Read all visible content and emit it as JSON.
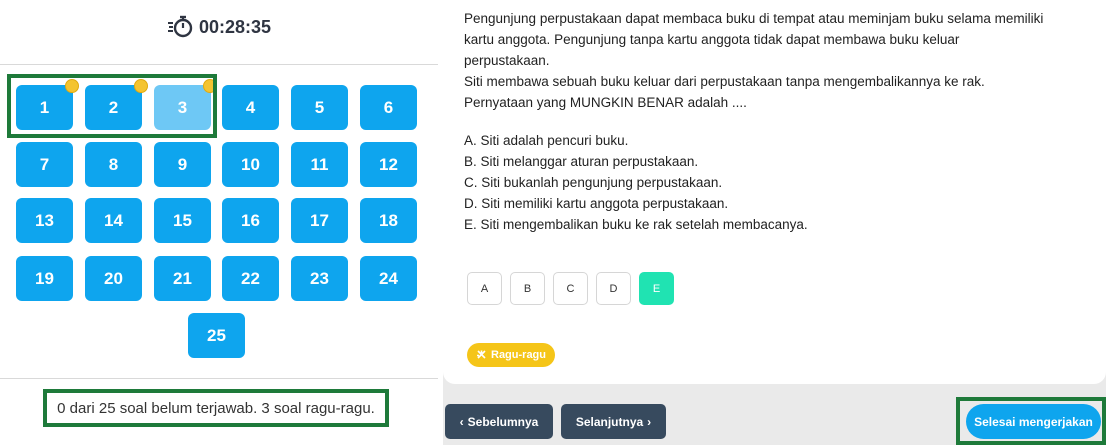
{
  "timer": {
    "icon": "stopwatch-icon",
    "text": "00:28:35"
  },
  "questions": [
    {
      "n": "1",
      "flag": true,
      "current": false
    },
    {
      "n": "2",
      "flag": true,
      "current": false
    },
    {
      "n": "3",
      "flag": true,
      "current": true
    },
    {
      "n": "4"
    },
    {
      "n": "5"
    },
    {
      "n": "6"
    },
    {
      "n": "7"
    },
    {
      "n": "8"
    },
    {
      "n": "9"
    },
    {
      "n": "10"
    },
    {
      "n": "11"
    },
    {
      "n": "12"
    },
    {
      "n": "13"
    },
    {
      "n": "14"
    },
    {
      "n": "15"
    },
    {
      "n": "16"
    },
    {
      "n": "17"
    },
    {
      "n": "18"
    },
    {
      "n": "19"
    },
    {
      "n": "20"
    },
    {
      "n": "21"
    },
    {
      "n": "22"
    },
    {
      "n": "23"
    },
    {
      "n": "24"
    },
    {
      "n": "25"
    }
  ],
  "status_text": "0 dari 25 soal belum terjawab. 3 soal ragu-ragu.",
  "question": {
    "lines": [
      "Pengunjung perpustakaan dapat membaca buku di tempat atau meminjam buku selama memiliki",
      "kartu anggota. Pengunjung tanpa kartu anggota tidak dapat membawa buku keluar",
      "perpustakaan.",
      "Siti membawa sebuah buku keluar dari perpustakaan tanpa mengembalikannya ke rak.",
      "Pernyataan yang MUNGKIN BENAR adalah ...."
    ],
    "options": [
      "A. Siti adalah pencuri buku.",
      "B. Siti melanggar aturan perpustakaan.",
      "C. Siti bukanlah pengunjung perpustakaan.",
      "D. Siti memiliki kartu anggota perpustakaan.",
      "E. Siti mengembalikan buku ke rak setelah membacanya."
    ]
  },
  "answers": {
    "labels": [
      "A",
      "B",
      "C",
      "D",
      "E"
    ],
    "selected": "E"
  },
  "ragu_label": "Ragu-ragu",
  "nav": {
    "prev_label": "Sebelumnya",
    "next_label": "Selanjutnya",
    "finish_label": "Selesai mengerjakan"
  },
  "colors": {
    "question_button": "#0ea5ee",
    "current_question": "#6ec8f5",
    "flag_dot": "#f4c430",
    "highlight": "#1e7a3a",
    "selected_answer": "#20e3b2",
    "ragu": "#f5c518",
    "nav_dark": "#374a5e"
  }
}
